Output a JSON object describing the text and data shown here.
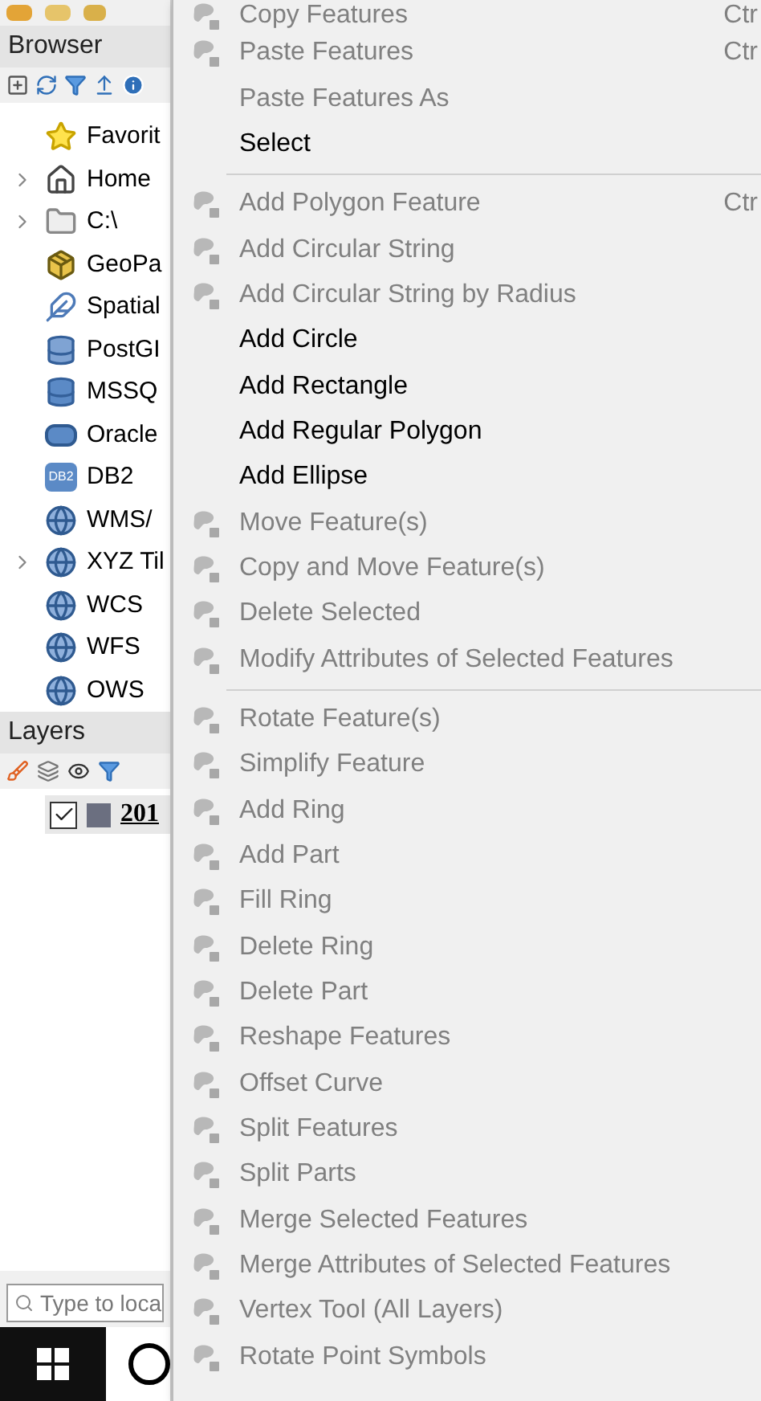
{
  "browser": {
    "title": "Browser",
    "items": [
      {
        "label": "Favorit",
        "expandable": false
      },
      {
        "label": "Home",
        "expandable": true
      },
      {
        "label": "C:\\",
        "expandable": true
      },
      {
        "label": "GeoPa",
        "expandable": false
      },
      {
        "label": "Spatial",
        "expandable": false
      },
      {
        "label": "PostGI",
        "expandable": false
      },
      {
        "label": "MSSQ",
        "expandable": false
      },
      {
        "label": "Oracle",
        "expandable": false
      },
      {
        "label": "DB2",
        "expandable": false,
        "badge": "DB2"
      },
      {
        "label": "WMS/",
        "expandable": false
      },
      {
        "label": "XYZ Til",
        "expandable": true
      },
      {
        "label": "WCS",
        "expandable": false
      },
      {
        "label": "WFS",
        "expandable": false
      },
      {
        "label": "OWS",
        "expandable": false
      }
    ]
  },
  "layers": {
    "title": "Layers",
    "items": [
      {
        "label": "201",
        "checked": true,
        "color": "#6b6f80"
      }
    ]
  },
  "locator": {
    "placeholder": "Type to loca"
  },
  "context_menu": {
    "items": [
      {
        "kind": "item",
        "label": "Copy Features",
        "enabled": false,
        "icon": true,
        "shortcut": "Ctr"
      },
      {
        "kind": "item",
        "label": "Paste Features",
        "enabled": false,
        "icon": true,
        "shortcut": "Ctr"
      },
      {
        "kind": "item",
        "label": "Paste Features As",
        "enabled": false,
        "icon": false
      },
      {
        "kind": "item",
        "label": "Select",
        "enabled": true,
        "icon": false
      },
      {
        "kind": "separator"
      },
      {
        "kind": "item",
        "label": "Add Polygon Feature",
        "enabled": false,
        "icon": true,
        "shortcut": "Ctr"
      },
      {
        "kind": "item",
        "label": "Add Circular String",
        "enabled": false,
        "icon": true
      },
      {
        "kind": "item",
        "label": "Add Circular String by Radius",
        "enabled": false,
        "icon": true
      },
      {
        "kind": "item",
        "label": "Add Circle",
        "enabled": true,
        "icon": false
      },
      {
        "kind": "item",
        "label": "Add Rectangle",
        "enabled": true,
        "icon": false
      },
      {
        "kind": "item",
        "label": "Add Regular Polygon",
        "enabled": true,
        "icon": false
      },
      {
        "kind": "item",
        "label": "Add Ellipse",
        "enabled": true,
        "icon": false
      },
      {
        "kind": "item",
        "label": "Move Feature(s)",
        "enabled": false,
        "icon": true
      },
      {
        "kind": "item",
        "label": "Copy and Move Feature(s)",
        "enabled": false,
        "icon": true
      },
      {
        "kind": "item",
        "label": "Delete Selected",
        "enabled": false,
        "icon": true
      },
      {
        "kind": "item",
        "label": "Modify Attributes of Selected Features",
        "enabled": false,
        "icon": true
      },
      {
        "kind": "separator"
      },
      {
        "kind": "item",
        "label": "Rotate Feature(s)",
        "enabled": false,
        "icon": true
      },
      {
        "kind": "item",
        "label": "Simplify Feature",
        "enabled": false,
        "icon": true
      },
      {
        "kind": "item",
        "label": "Add Ring",
        "enabled": false,
        "icon": true
      },
      {
        "kind": "item",
        "label": "Add Part",
        "enabled": false,
        "icon": true
      },
      {
        "kind": "item",
        "label": "Fill Ring",
        "enabled": false,
        "icon": true
      },
      {
        "kind": "item",
        "label": "Delete Ring",
        "enabled": false,
        "icon": true
      },
      {
        "kind": "item",
        "label": "Delete Part",
        "enabled": false,
        "icon": true
      },
      {
        "kind": "item",
        "label": "Reshape Features",
        "enabled": false,
        "icon": true
      },
      {
        "kind": "item",
        "label": "Offset Curve",
        "enabled": false,
        "icon": true
      },
      {
        "kind": "item",
        "label": "Split Features",
        "enabled": false,
        "icon": true
      },
      {
        "kind": "item",
        "label": "Split Parts",
        "enabled": false,
        "icon": true
      },
      {
        "kind": "item",
        "label": "Merge Selected Features",
        "enabled": false,
        "icon": true
      },
      {
        "kind": "item",
        "label": "Merge Attributes of Selected Features",
        "enabled": false,
        "icon": true
      },
      {
        "kind": "item",
        "label": "Vertex Tool (All Layers)",
        "enabled": false,
        "icon": true
      },
      {
        "kind": "item",
        "label": "Rotate Point Symbols",
        "enabled": false,
        "icon": true
      }
    ]
  }
}
